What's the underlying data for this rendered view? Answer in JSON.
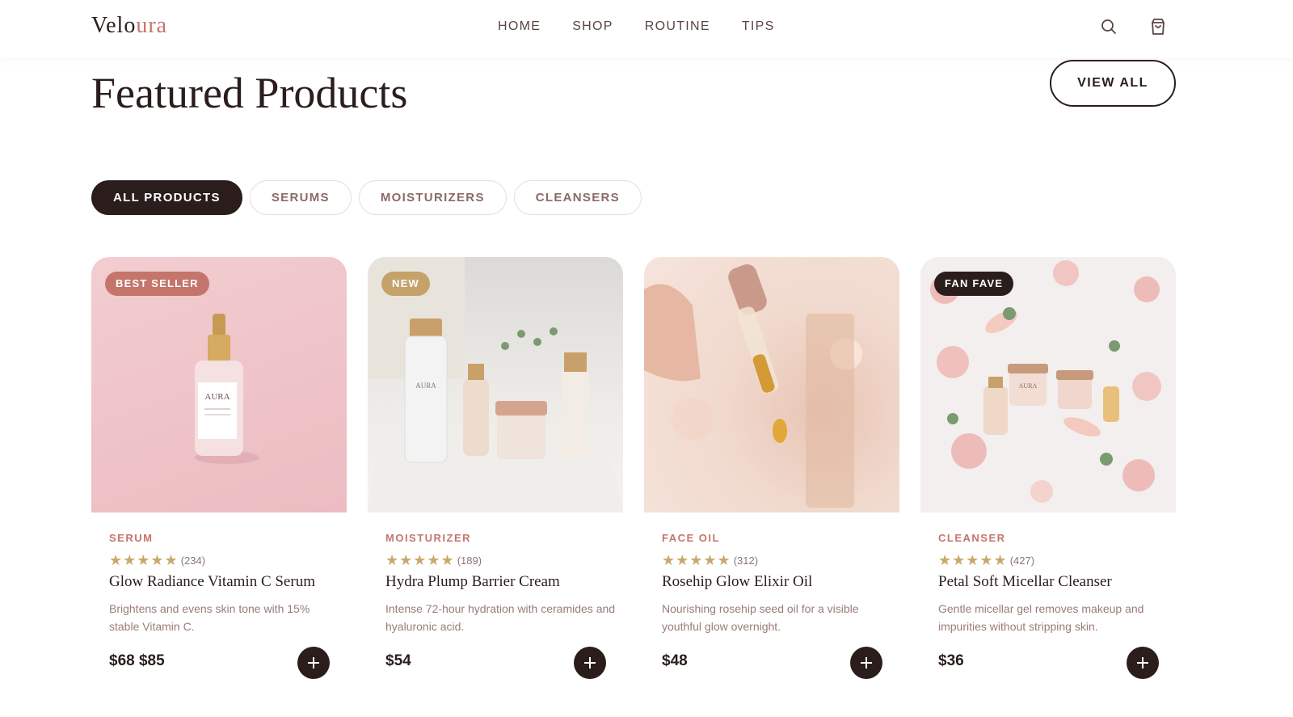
{
  "brand": {
    "name_a": "Velo",
    "name_b": "ura",
    "accent_color": "#c4756c"
  },
  "nav": [
    {
      "label": "HOME"
    },
    {
      "label": "SHOP"
    },
    {
      "label": "ROUTINE"
    },
    {
      "label": "TIPS"
    }
  ],
  "header_icons": [
    "search-icon",
    "shopping-bag-icon"
  ],
  "section": {
    "title": "Featured Products",
    "view_all": "VIEW ALL"
  },
  "filters": [
    {
      "label": "ALL PRODUCTS",
      "active": true
    },
    {
      "label": "SERUMS",
      "active": false
    },
    {
      "label": "MOISTURIZERS",
      "active": false
    },
    {
      "label": "CLEANSERS",
      "active": false
    }
  ],
  "products": [
    {
      "badge": "BEST SELLER",
      "badge_color": "#c4756c",
      "category": "SERUM",
      "stars": "★★★★★",
      "reviews": "(234)",
      "name": "Glow Radiance Vitamin C Serum",
      "description": "Brightens and evens skin tone with 15% stable Vitamin C.",
      "price": "$68 $85",
      "image_label": "AURA"
    },
    {
      "badge": "NEW",
      "badge_color": "#c4a26a",
      "category": "MOISTURIZER",
      "stars": "★★★★★",
      "reviews": "(189)",
      "name": "Hydra Plump Barrier Cream",
      "description": "Intense 72-hour hydration with ceramides and hyaluronic acid.",
      "price": "$54",
      "image_label": "AURA"
    },
    {
      "badge": "",
      "badge_color": "",
      "category": "FACE OIL",
      "stars": "★★★★★",
      "reviews": "(312)",
      "name": "Rosehip Glow Elixir Oil",
      "description": "Nourishing rosehip seed oil for a visible youthful glow overnight.",
      "price": "$48",
      "image_label": ""
    },
    {
      "badge": "FAN FAVE",
      "badge_color": "#2a1d1c",
      "category": "CLEANSER",
      "stars": "★★★★★",
      "reviews": "(427)",
      "name": "Petal Soft Micellar Cleanser",
      "description": "Gentle micellar gel removes makeup and impurities without stripping skin.",
      "price": "$36",
      "image_label": "AURA"
    }
  ]
}
